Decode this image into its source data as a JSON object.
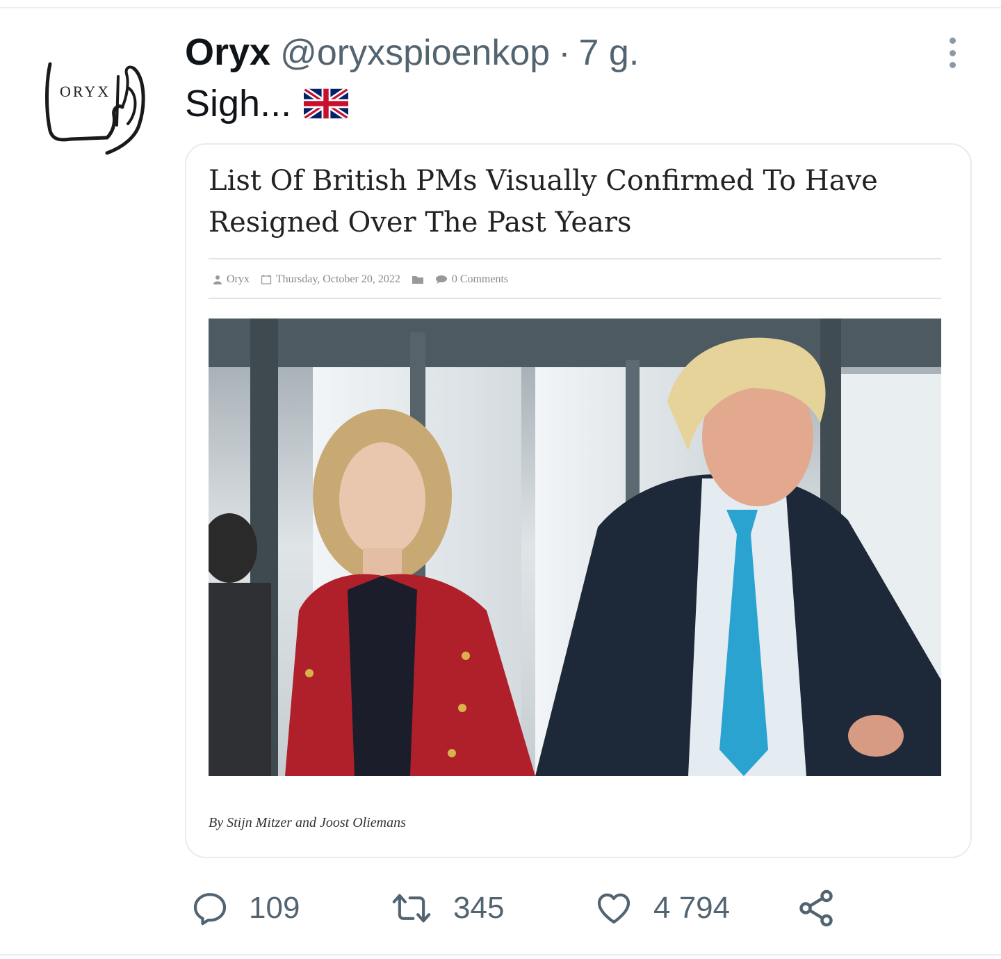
{
  "tweet": {
    "display_name": "Oryx",
    "handle": "@oryxspioenkop",
    "separator": "·",
    "time": "7 g.",
    "text": "Sigh...",
    "avatar_label": "ORYX",
    "flag_icon": "uk-flag-icon"
  },
  "card": {
    "title": "List Of British PMs Visually Confirmed To Have Resigned Over The Past Years",
    "meta": {
      "author": "Oryx",
      "date": "Thursday, October 20, 2022",
      "comments": "0 Comments"
    },
    "byline": "By Stijn Mitzer and Joost Oliemans"
  },
  "actions": {
    "reply_count": "109",
    "retweet_count": "345",
    "like_count": "4 794"
  },
  "colors": {
    "text_primary": "#0f1419",
    "text_secondary": "#536471",
    "border": "#e6ecf0"
  }
}
